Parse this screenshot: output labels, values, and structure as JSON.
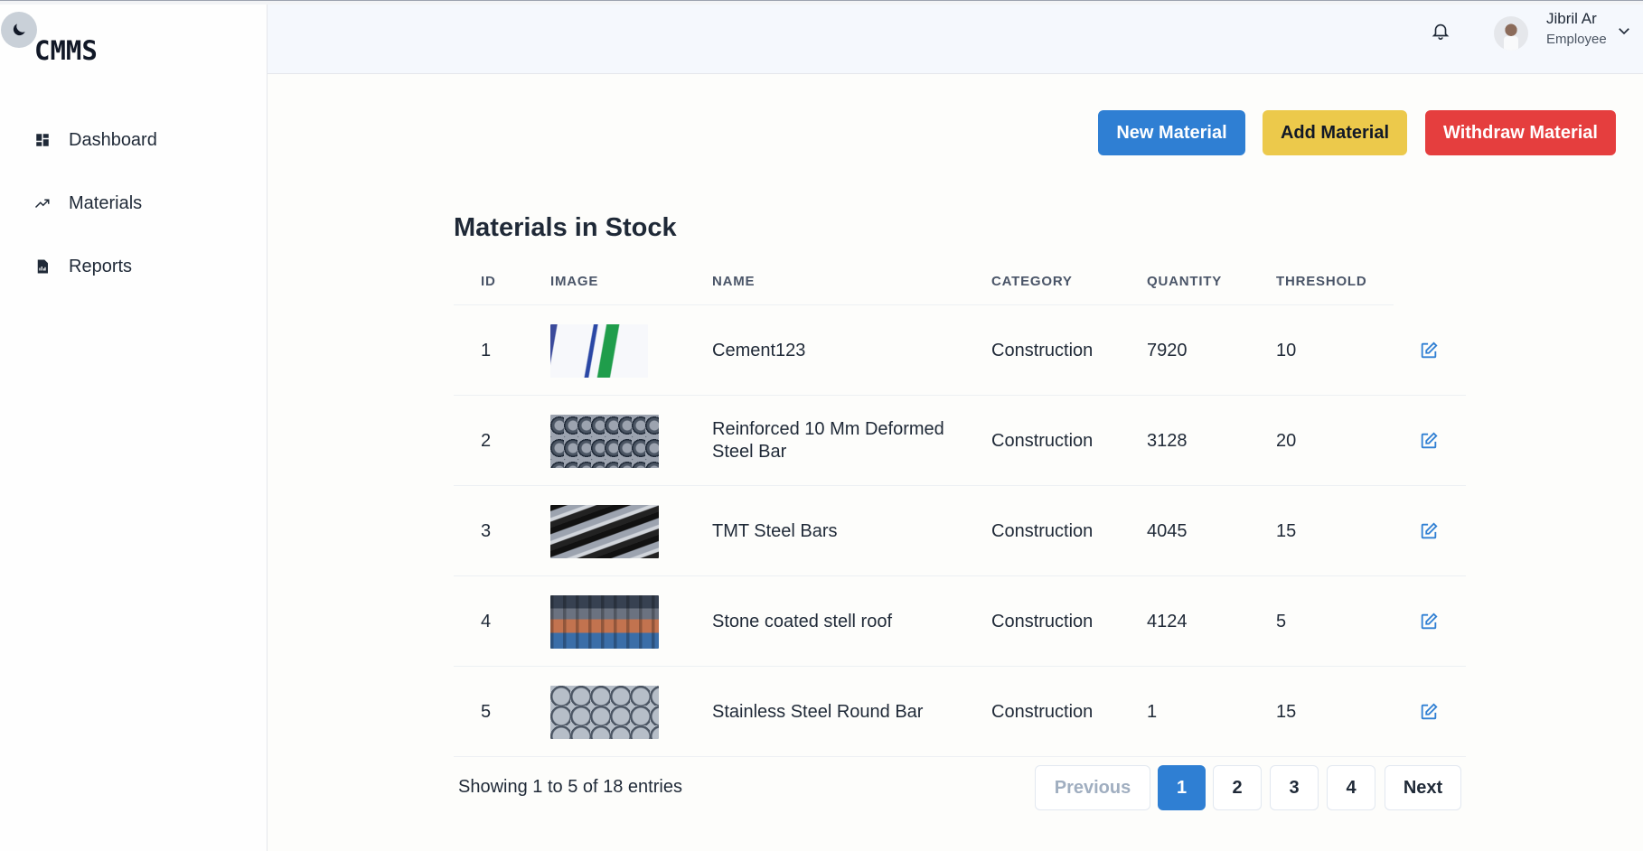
{
  "app": {
    "logo": "CMMS"
  },
  "sidebar": {
    "items": [
      {
        "label": "Dashboard",
        "icon": "dashboard-icon"
      },
      {
        "label": "Materials",
        "icon": "trending-up-icon"
      },
      {
        "label": "Reports",
        "icon": "report-icon"
      }
    ]
  },
  "header": {
    "user_name": "Jibril Ar",
    "user_role": "Employee"
  },
  "actions": {
    "new_material": "New Material",
    "add_material": "Add Material",
    "withdraw_material": "Withdraw Material"
  },
  "colors": {
    "primary": "#2f7fd3",
    "warning": "#ecc94b",
    "danger": "#e53e3e"
  },
  "table": {
    "title": "Materials in Stock",
    "columns": [
      "ID",
      "IMAGE",
      "NAME",
      "CATEGORY",
      "QUANTITY",
      "THRESHOLD"
    ],
    "rows": [
      {
        "id": "1",
        "name": "Cement123",
        "category": "Construction",
        "quantity": "7920",
        "threshold": "10"
      },
      {
        "id": "2",
        "name": "Reinforced 10 Mm Deformed Steel Bar",
        "category": "Construction",
        "quantity": "3128",
        "threshold": "20"
      },
      {
        "id": "3",
        "name": "TMT Steel Bars",
        "category": "Construction",
        "quantity": "4045",
        "threshold": "15"
      },
      {
        "id": "4",
        "name": "Stone coated stell roof",
        "category": "Construction",
        "quantity": "4124",
        "threshold": "5"
      },
      {
        "id": "5",
        "name": "Stainless Steel Round Bar",
        "category": "Construction",
        "quantity": "1",
        "threshold": "15"
      }
    ]
  },
  "pagination": {
    "summary": "Showing 1 to 5 of 18 entries",
    "previous": "Previous",
    "pages": [
      "1",
      "2",
      "3",
      "4"
    ],
    "current": "1",
    "next": "Next"
  }
}
